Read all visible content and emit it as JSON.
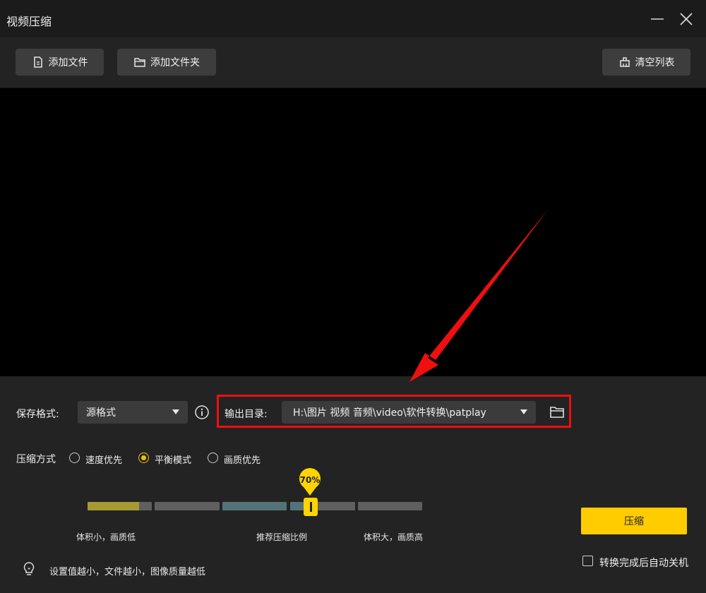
{
  "window": {
    "title": "视频压缩"
  },
  "toolbar": {
    "add_file": "添加文件",
    "add_folder": "添加文件夹",
    "clear_list": "清空列表"
  },
  "settings": {
    "save_format_label": "保存格式:",
    "save_format_value": "源格式",
    "output_dir_label": "输出目录:",
    "output_dir_value": "H:\\图片 视频 音频\\video\\软件转换\\patplay",
    "compress_mode_label": "压缩方式",
    "modes": [
      {
        "label": "速度优先",
        "selected": false
      },
      {
        "label": "平衡模式",
        "selected": true
      },
      {
        "label": "画质优先",
        "selected": false
      }
    ]
  },
  "slider": {
    "value_text": "70%",
    "value_percent": 70,
    "segment_colors": [
      "#a79a33",
      "#5f5f5f",
      "#547378",
      "#5f5f5f",
      "#5f5f5f"
    ],
    "label_left": "体积小，画质低",
    "label_mid": "推荐压缩比例",
    "label_right": "体积大，画质高"
  },
  "hint": "设置值越小，文件越小，图像质量越低",
  "actions": {
    "compress": "压缩",
    "auto_shutdown": "转换完成后自动关机",
    "auto_shutdown_checked": false
  },
  "colors": {
    "accent": "#ffcc00",
    "highlight_box": "#ef0f0f",
    "annotation_arrow": "#ef0f0f"
  }
}
